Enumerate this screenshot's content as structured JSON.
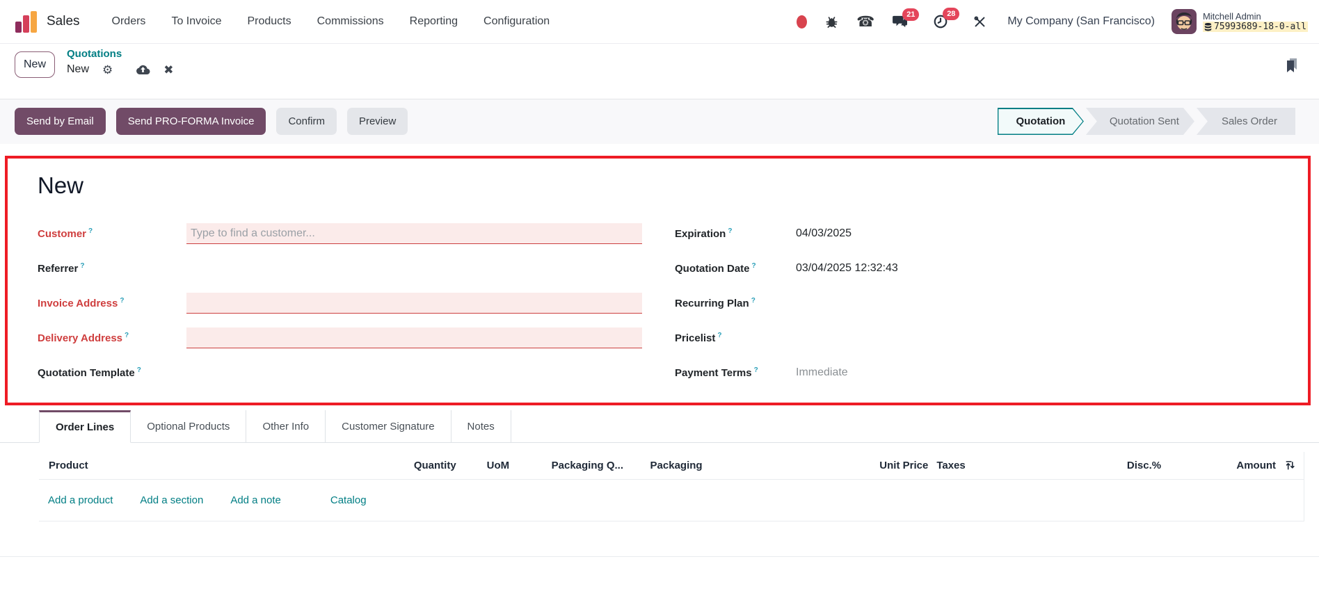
{
  "colors": {
    "brand_purple": "#714b67",
    "link_teal": "#017e84",
    "required_red": "#cf3e3e",
    "required_field_bg": "#fbebea",
    "badge_red": "#e4455a",
    "annotation_red": "#ee1c25",
    "db_chip_bg": "#fdf0c5"
  },
  "navbar": {
    "app_name": "Sales",
    "menu_items": [
      "Orders",
      "To Invoice",
      "Products",
      "Commissions",
      "Reporting",
      "Configuration"
    ],
    "chat_badge": "21",
    "activities_badge": "28",
    "company": "My Company (San Francisco)",
    "user_name": "Mitchell Admin",
    "db_identifier": "75993689-18-0-all"
  },
  "breadcrumb": {
    "new_button": "New",
    "parent": "Quotations",
    "current": "New"
  },
  "actions": {
    "send_email": "Send by Email",
    "send_proforma": "Send PRO-FORMA Invoice",
    "confirm": "Confirm",
    "preview": "Preview"
  },
  "statusbar": {
    "steps": [
      {
        "label": "Quotation",
        "active": true
      },
      {
        "label": "Quotation Sent",
        "active": false
      },
      {
        "label": "Sales Order",
        "active": false
      }
    ]
  },
  "form": {
    "title": "New",
    "help_marker": "?",
    "left_fields": [
      {
        "label": "Customer",
        "required": true,
        "placeholder": "Type to find a customer...",
        "value": ""
      },
      {
        "label": "Referrer",
        "required": false,
        "value": ""
      },
      {
        "label": "Invoice Address",
        "required": true,
        "value": ""
      },
      {
        "label": "Delivery Address",
        "required": true,
        "value": ""
      },
      {
        "label": "Quotation Template",
        "required": false,
        "value": ""
      }
    ],
    "right_fields": [
      {
        "label": "Expiration",
        "value": "04/03/2025"
      },
      {
        "label": "Quotation Date",
        "value": "03/04/2025 12:32:43"
      },
      {
        "label": "Recurring Plan",
        "value": ""
      },
      {
        "label": "Pricelist",
        "value": ""
      },
      {
        "label": "Payment Terms",
        "value": "Immediate"
      }
    ]
  },
  "tabs": [
    {
      "label": "Order Lines",
      "active": true
    },
    {
      "label": "Optional Products",
      "active": false
    },
    {
      "label": "Other Info",
      "active": false
    },
    {
      "label": "Customer Signature",
      "active": false
    },
    {
      "label": "Notes",
      "active": false
    }
  ],
  "order_lines": {
    "columns": {
      "product": "Product",
      "quantity": "Quantity",
      "uom": "UoM",
      "packaging_qty": "Packaging Q...",
      "packaging": "Packaging",
      "unit_price": "Unit Price",
      "taxes": "Taxes",
      "disc": "Disc.%",
      "amount": "Amount"
    },
    "row_actions": {
      "add_product": "Add a product",
      "add_section": "Add a section",
      "add_note": "Add a note",
      "catalog": "Catalog"
    }
  }
}
